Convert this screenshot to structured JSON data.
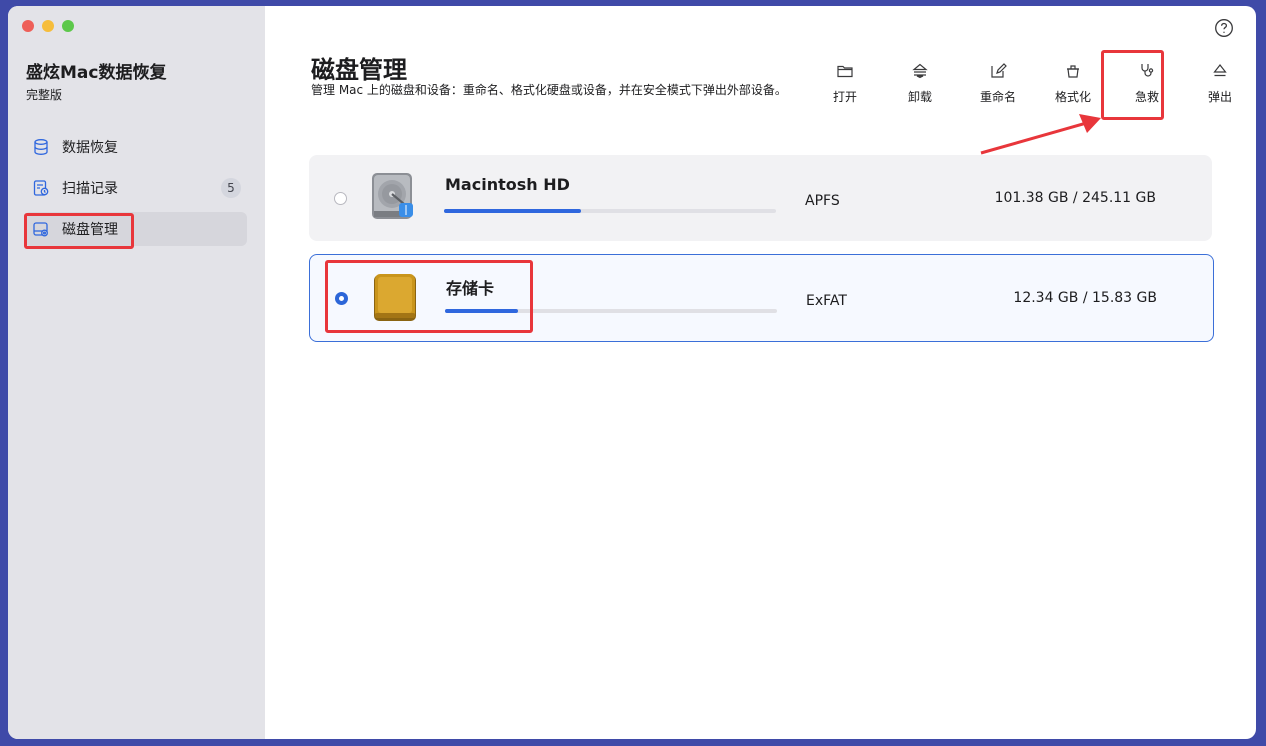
{
  "app": {
    "title": "盛炫Mac数据恢复",
    "edition": "完整版"
  },
  "sidebar": {
    "items": [
      {
        "label": "数据恢复",
        "icon": "database-icon"
      },
      {
        "label": "扫描记录",
        "icon": "scan-history-icon",
        "badge": "5"
      },
      {
        "label": "磁盘管理",
        "icon": "disk-manage-icon",
        "active": true
      }
    ]
  },
  "main": {
    "title": "磁盘管理",
    "description": "管理 Mac 上的磁盘和设备：重命名、格式化硬盘或设备，并在安全模式下弹出外部设备。"
  },
  "toolbar": {
    "items": [
      {
        "label": "打开",
        "icon": "folder-icon"
      },
      {
        "label": "卸载",
        "icon": "unmount-icon"
      },
      {
        "label": "重命名",
        "icon": "rename-icon"
      },
      {
        "label": "格式化",
        "icon": "format-icon"
      },
      {
        "label": "急救",
        "icon": "stethoscope-icon"
      },
      {
        "label": "弹出",
        "icon": "eject-icon"
      }
    ]
  },
  "disks": [
    {
      "name": "Macintosh HD",
      "filesystem": "APFS",
      "capacity": "101.38 GB / 245.11 GB",
      "usage_fraction": 0.414,
      "selected": false,
      "icon": "hard-drive-icon"
    },
    {
      "name": "存储卡",
      "filesystem": "ExFAT",
      "capacity": "12.34 GB / 15.83 GB",
      "usage_fraction": 0.22,
      "selected": true,
      "icon": "memory-card-icon"
    }
  ],
  "colors": {
    "accent": "#2f67de",
    "highlight": "#e8363b",
    "frame": "#3f4aa8"
  }
}
